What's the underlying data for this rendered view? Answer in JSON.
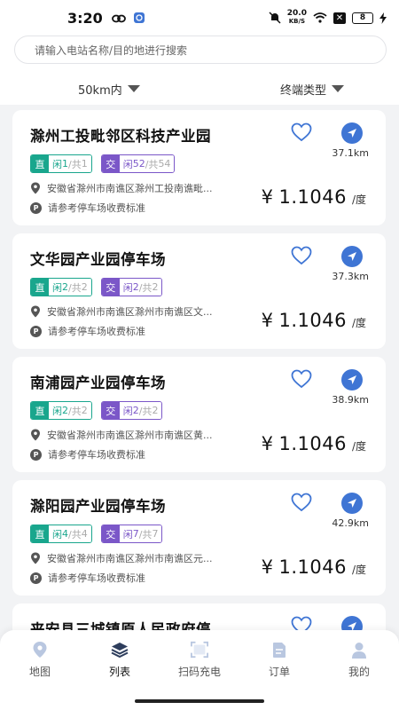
{
  "status_bar": {
    "time": "3:20",
    "net_speed_value": "20.0",
    "net_speed_unit": "KB/S",
    "battery": "8"
  },
  "search": {
    "placeholder": "请输入电站名称/目的地进行搜索"
  },
  "filters": {
    "distance": "50km内",
    "terminal_type": "终端类型"
  },
  "labels": {
    "dc_tag": "直",
    "ac_tag": "交",
    "free_prefix": "闲",
    "total_prefix": "/共",
    "currency": "¥",
    "price_unit": "/度",
    "parking_note": "请参考停车场收费标准"
  },
  "stations": [
    {
      "name": "滁州工投毗邻区科技产业园",
      "distance": "37.1km",
      "dc_free": "1",
      "dc_total": "1",
      "ac_free": "52",
      "ac_total": "54",
      "address": "安徽省滁州市南谯区滁州工投南谯毗...",
      "price": "1.1046"
    },
    {
      "name": "文华园产业园停车场",
      "distance": "37.3km",
      "dc_free": "2",
      "dc_total": "2",
      "ac_free": "2",
      "ac_total": "2",
      "address": "安徽省滁州市南谯区滁州市南谯区文...",
      "price": "1.1046"
    },
    {
      "name": "南浦园产业园停车场",
      "distance": "38.9km",
      "dc_free": "2",
      "dc_total": "2",
      "ac_free": "2",
      "ac_total": "2",
      "address": "安徽省滁州市南谯区滁州市南谯区黄...",
      "price": "1.1046"
    },
    {
      "name": "滁阳园产业园停车场",
      "distance": "42.9km",
      "dc_free": "4",
      "dc_total": "4",
      "ac_free": "7",
      "ac_total": "7",
      "address": "安徽省滁州市南谯区滁州市南谯区元...",
      "price": "1.1046"
    },
    {
      "name": "来安县三城镇原人民政府停",
      "distance": "",
      "dc_free": "",
      "dc_total": "",
      "ac_free": "",
      "ac_total": "",
      "address": "",
      "price": ""
    }
  ],
  "nav": [
    {
      "label": "地图",
      "icon": "map-pin-icon"
    },
    {
      "label": "列表",
      "icon": "layers-icon"
    },
    {
      "label": "扫码充电",
      "icon": "scan-icon"
    },
    {
      "label": "订单",
      "icon": "document-icon"
    },
    {
      "label": "我的",
      "icon": "user-icon"
    }
  ],
  "colors": {
    "dc": "#19a68d",
    "ac": "#7b57c8",
    "accent": "#3f75d4",
    "heart": "#3f75d4"
  }
}
